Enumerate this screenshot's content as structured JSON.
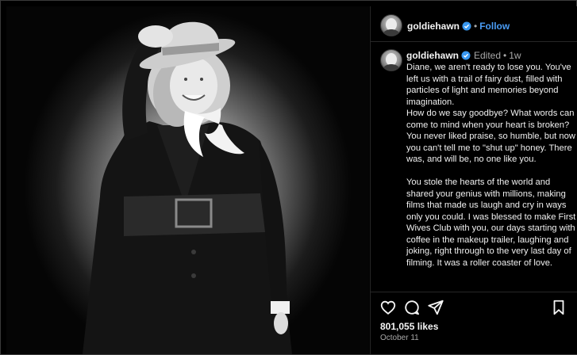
{
  "post": {
    "username": "goldiehawn",
    "follow_label": "Follow",
    "separator": "•",
    "edited_label": "Edited",
    "age": "1w",
    "caption": "Diane, we aren't ready to lose you. You've left us with a trail of fairy dust, filled with particles of light and memories beyond imagination.\nHow do we say goodbye? What words can come to mind when your heart is broken? You never liked praise, so humble, but now you can't tell me to \"shut up\" honey. There was, and will be, no one like you.\n\nYou stole the hearts of the world and shared your genius with millions, making films that made us laugh and cry in ways only you could. I was blessed to make First Wives Club with you, our days starting with coffee in the makeup trailer, laughing and joking, right through to the very last day of filming. It was a roller coaster of love.",
    "likes": "801,055 likes",
    "date": "October 11"
  },
  "icons": {
    "verified": "verified-badge-icon",
    "like": "heart-icon",
    "comment": "comment-icon",
    "share": "share-icon",
    "save": "bookmark-icon"
  },
  "colors": {
    "background": "#000000",
    "link": "#4a9cf5",
    "verified": "#3897f0",
    "muted": "#a8a8a8"
  }
}
